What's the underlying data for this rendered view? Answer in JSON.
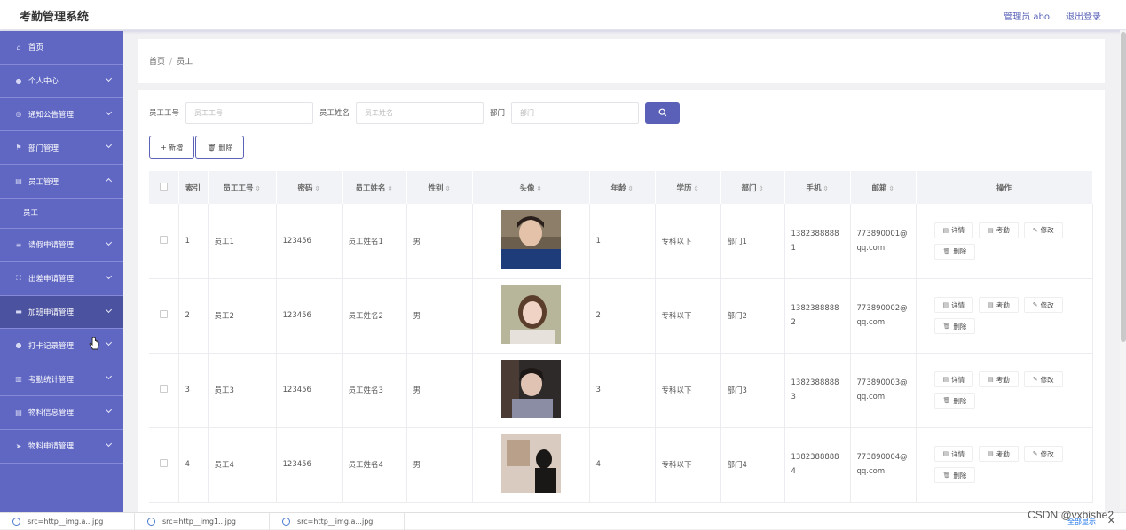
{
  "app": {
    "title": "考勤管理系统",
    "user": "管理员 abo",
    "logout": "退出登录"
  },
  "sidebar": {
    "items": [
      {
        "label": "首页",
        "icon": "home-icon"
      },
      {
        "label": "个人中心",
        "icon": "user-icon"
      },
      {
        "label": "通知公告管理",
        "icon": "globe-icon"
      },
      {
        "label": "部门管理",
        "icon": "flag-icon"
      },
      {
        "label": "员工管理",
        "icon": "doc-icon"
      },
      {
        "label": "员工",
        "icon": ""
      },
      {
        "label": "请假申请管理",
        "icon": "menu-icon"
      },
      {
        "label": "出差申请管理",
        "icon": "expand-icon"
      },
      {
        "label": "加班申请管理",
        "icon": "chat-icon"
      },
      {
        "label": "打卡记录管理",
        "icon": "user-icon"
      },
      {
        "label": "考勤统计管理",
        "icon": "chart-icon"
      },
      {
        "label": "物料信息管理",
        "icon": "doc-icon"
      },
      {
        "label": "物料申请管理",
        "icon": "send-icon"
      }
    ]
  },
  "breadcrumb": {
    "home": "首页",
    "sep": "/",
    "current": "员工"
  },
  "search": {
    "id_label": "员工工号",
    "id_placeholder": "员工工号",
    "name_label": "员工姓名",
    "name_placeholder": "员工姓名",
    "dept_label": "部门",
    "dept_placeholder": "部门"
  },
  "buttons": {
    "add": "+ 新增",
    "delete": "删除"
  },
  "table": {
    "headers": [
      "索引",
      "员工工号",
      "密码",
      "员工姓名",
      "性别",
      "头像",
      "年龄",
      "学历",
      "部门",
      "手机",
      "邮箱",
      "操作"
    ],
    "actions": {
      "detail": "详情",
      "attendance": "考勤",
      "edit": "修改",
      "delete": "删除"
    },
    "rows": [
      {
        "index": "1",
        "id": "员工1",
        "password": "123456",
        "name": "员工姓名1",
        "gender": "男",
        "age": "1",
        "edu": "专科以下",
        "dept": "部门1",
        "phone_a": "1382388888",
        "phone_b": "1",
        "email_a": "773890001@",
        "email_b": "qq.com"
      },
      {
        "index": "2",
        "id": "员工2",
        "password": "123456",
        "name": "员工姓名2",
        "gender": "男",
        "age": "2",
        "edu": "专科以下",
        "dept": "部门2",
        "phone_a": "1382388888",
        "phone_b": "2",
        "email_a": "773890002@",
        "email_b": "qq.com"
      },
      {
        "index": "3",
        "id": "员工3",
        "password": "123456",
        "name": "员工姓名3",
        "gender": "男",
        "age": "3",
        "edu": "专科以下",
        "dept": "部门3",
        "phone_a": "1382388888",
        "phone_b": "3",
        "email_a": "773890003@",
        "email_b": "qq.com"
      },
      {
        "index": "4",
        "id": "员工4",
        "password": "123456",
        "name": "员工姓名4",
        "gender": "男",
        "age": "4",
        "edu": "专科以下",
        "dept": "部门4",
        "phone_a": "1382388888",
        "phone_b": "4",
        "email_a": "773890004@",
        "email_b": "qq.com"
      }
    ]
  },
  "downloads": {
    "items": [
      "src=http__img.a...jpg",
      "src=http__img1...jpg",
      "src=http__img.a...jpg"
    ],
    "show_all": "全部显示"
  },
  "watermark": "CSDN @vxbishe2",
  "colors": {
    "sidebar": "#6067c3",
    "sidebar_active": "#4b529f",
    "accent": "#5a5fb8"
  }
}
